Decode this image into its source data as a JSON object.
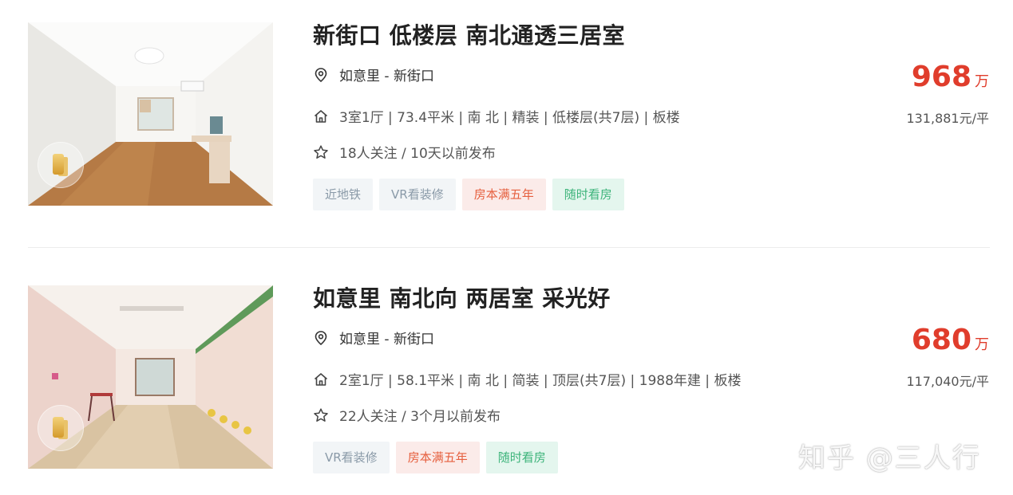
{
  "listings": [
    {
      "title": "新街口 低楼层 南北通透三居室",
      "location": "如意里 - 新街口",
      "info": "3室1厅 | 73.4平米 | 南 北 | 精装 | 低楼层(共7层) | 板楼",
      "follow": "18人关注 / 10天以前发布",
      "tags": [
        {
          "label": "近地铁",
          "style": "gray"
        },
        {
          "label": "VR看装修",
          "style": "gray"
        },
        {
          "label": "房本满五年",
          "style": "red"
        },
        {
          "label": "随时看房",
          "style": "green"
        }
      ],
      "price": "968",
      "price_unit": "万",
      "unit_price": "131,881元/平"
    },
    {
      "title": "如意里 南北向 两居室 采光好",
      "location": "如意里 - 新街口",
      "info": "2室1厅 | 58.1平米 | 南 北 | 简装 | 顶层(共7层) | 1988年建 | 板楼",
      "follow": "22人关注 / 3个月以前发布",
      "tags": [
        {
          "label": "VR看装修",
          "style": "gray"
        },
        {
          "label": "房本满五年",
          "style": "red"
        },
        {
          "label": "随时看房",
          "style": "green"
        }
      ],
      "price": "680",
      "price_unit": "万",
      "unit_price": "117,040元/平"
    }
  ],
  "icons": {
    "location": "location-pin-icon",
    "house": "house-icon",
    "follow": "star-icon"
  },
  "colors": {
    "price": "#e03d2c",
    "tag_gray_bg": "#f2f5f7",
    "tag_red_bg": "#fbebe9",
    "tag_green_bg": "#e4f6ee"
  },
  "watermark": "知乎 @三人行"
}
